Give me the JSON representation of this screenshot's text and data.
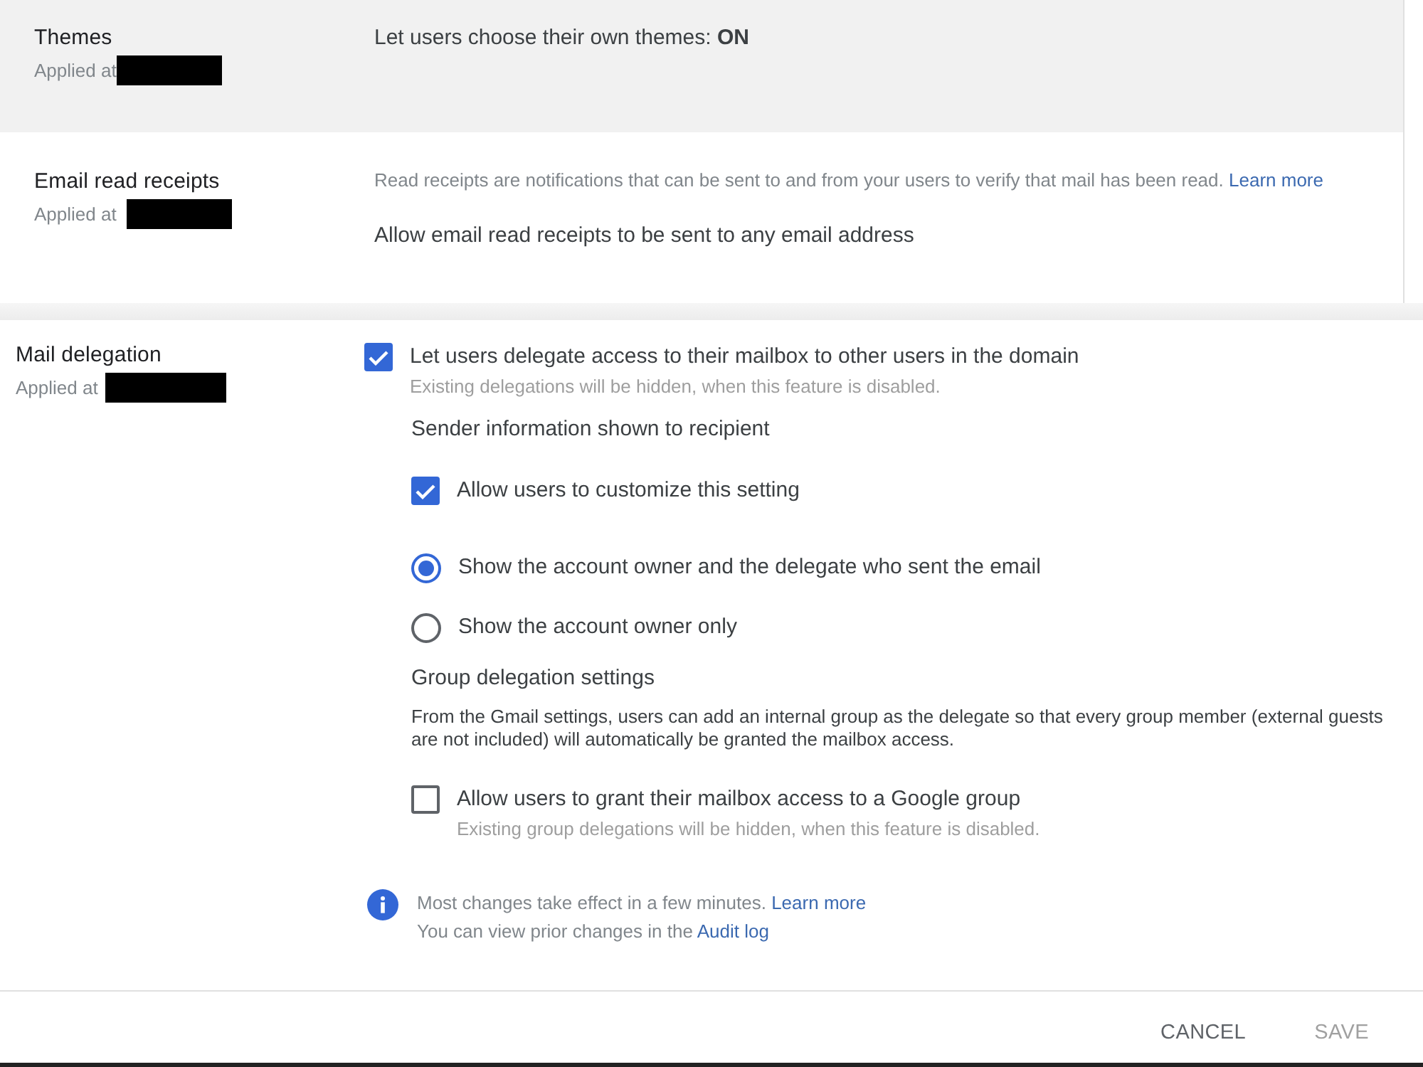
{
  "summary_rows": [
    {
      "title": "Themes",
      "applied_at": {
        "label": "Applied at",
        "redacted": true
      },
      "highlighted": true,
      "value": "Let users choose their own themes: **ON**"
    },
    {
      "title": "Email read receipts",
      "applied_at": {
        "label": "Applied at",
        "redacted": true
      },
      "highlighted": false,
      "description": {
        "text": "Read receipts are notifications that can be sent to and from your users to verify that mail has been read.",
        "link": "Learn more"
      },
      "value": "Allow email read receipts to be sent to any email address"
    }
  ],
  "mail_delegation": {
    "title": "Mail delegation",
    "applied_at": {
      "label": "Applied at",
      "redacted": true
    },
    "delegate_option": {
      "label": "Let users delegate access to their mailbox to other users in the domain",
      "checked": true,
      "hint": "Existing delegations will be hidden, when this feature is disabled."
    },
    "sender_info": {
      "heading": "Sender information shown to recipient",
      "customize_option": {
        "label": "Allow users to customize this setting",
        "checked": true
      },
      "options": [
        {
          "label": "Show the account owner and the delegate who sent the email",
          "selected": true
        },
        {
          "label": "Show the account owner only",
          "selected": false
        }
      ]
    },
    "group_delegation": {
      "heading": "Group delegation settings",
      "description": "From the Gmail settings, users can add an internal group as the delegate so that every group member (external guests are not included) will automatically be granted the mailbox access.",
      "option": {
        "label": "Allow users to grant their mailbox access to a Google group",
        "checked": false,
        "hint": "Existing group delegations will be hidden, when this feature is disabled."
      }
    },
    "info_note": {
      "lines": [
        {
          "text": "Most changes take effect in a few minutes.",
          "link": "Learn more"
        },
        {
          "text": "You can view prior changes in the",
          "link": "Audit log"
        }
      ]
    }
  },
  "footer": {
    "buttons": [
      {
        "label": "CANCEL",
        "disabled": false
      },
      {
        "label": "SAVE",
        "disabled": true
      }
    ]
  }
}
